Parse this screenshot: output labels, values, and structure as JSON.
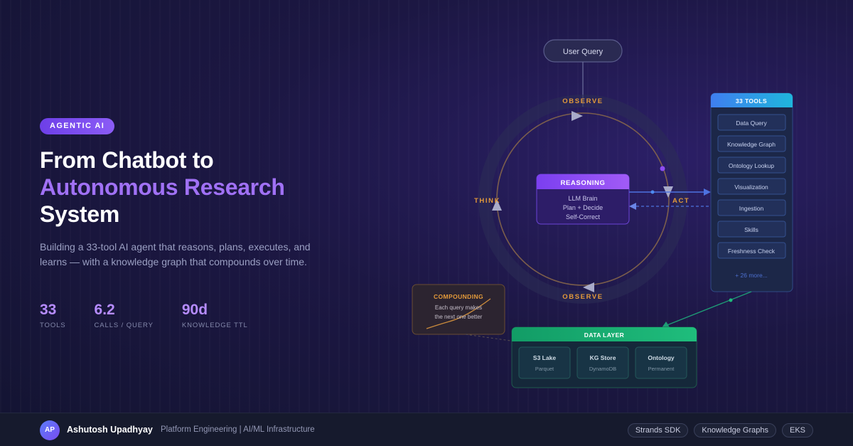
{
  "badge": "AGENTIC AI",
  "headline": {
    "line1": "From Chatbot to",
    "line2": "Autonomous Research",
    "line3": "System"
  },
  "description": "Building a 33-tool AI agent that reasons, plans, executes, and learns — with a knowledge graph that compounds over time.",
  "stats": [
    {
      "value": "33",
      "label": "TOOLS"
    },
    {
      "value": "6.2",
      "label": "CALLS / QUERY"
    },
    {
      "value": "90d",
      "label": "KNOWLEDGE TTL"
    }
  ],
  "diagram": {
    "user_query": "User Query",
    "observe_top": "OBSERVE",
    "observe_bottom": "OBSERVE",
    "think": "THINK",
    "act": "ACT",
    "reasoning": {
      "title": "REASONING",
      "lines": [
        "LLM Brain",
        "Plan + Decide",
        "Self-Correct"
      ]
    },
    "tools": {
      "title": "33 TOOLS",
      "items": [
        "Data Query",
        "Knowledge Graph",
        "Ontology Lookup",
        "Visualization",
        "Ingestion",
        "Skills",
        "Freshness Check"
      ],
      "more": "+ 26 more..."
    },
    "compounding": {
      "title": "COMPOUNDING",
      "line1": "Each query makes",
      "line2": "the next one better"
    },
    "data_layer": {
      "title": "DATA LAYER",
      "stores": [
        {
          "name": "S3 Lake",
          "sub": "Parquet"
        },
        {
          "name": "KG Store",
          "sub": "DynamoDB"
        },
        {
          "name": "Ontology",
          "sub": "Permanent"
        }
      ]
    },
    "colors": {
      "accent_purple": "#7c4df0",
      "accent_orange": "#e39a3a",
      "tools_header": "#1fa4e0",
      "data_header": "#17a56c"
    }
  },
  "footer": {
    "initials": "AP",
    "name": "Ashutosh Upadhyay",
    "role": "Platform Engineering | AI/ML Infrastructure",
    "tags": [
      "Strands SDK",
      "Knowledge Graphs",
      "EKS"
    ]
  }
}
